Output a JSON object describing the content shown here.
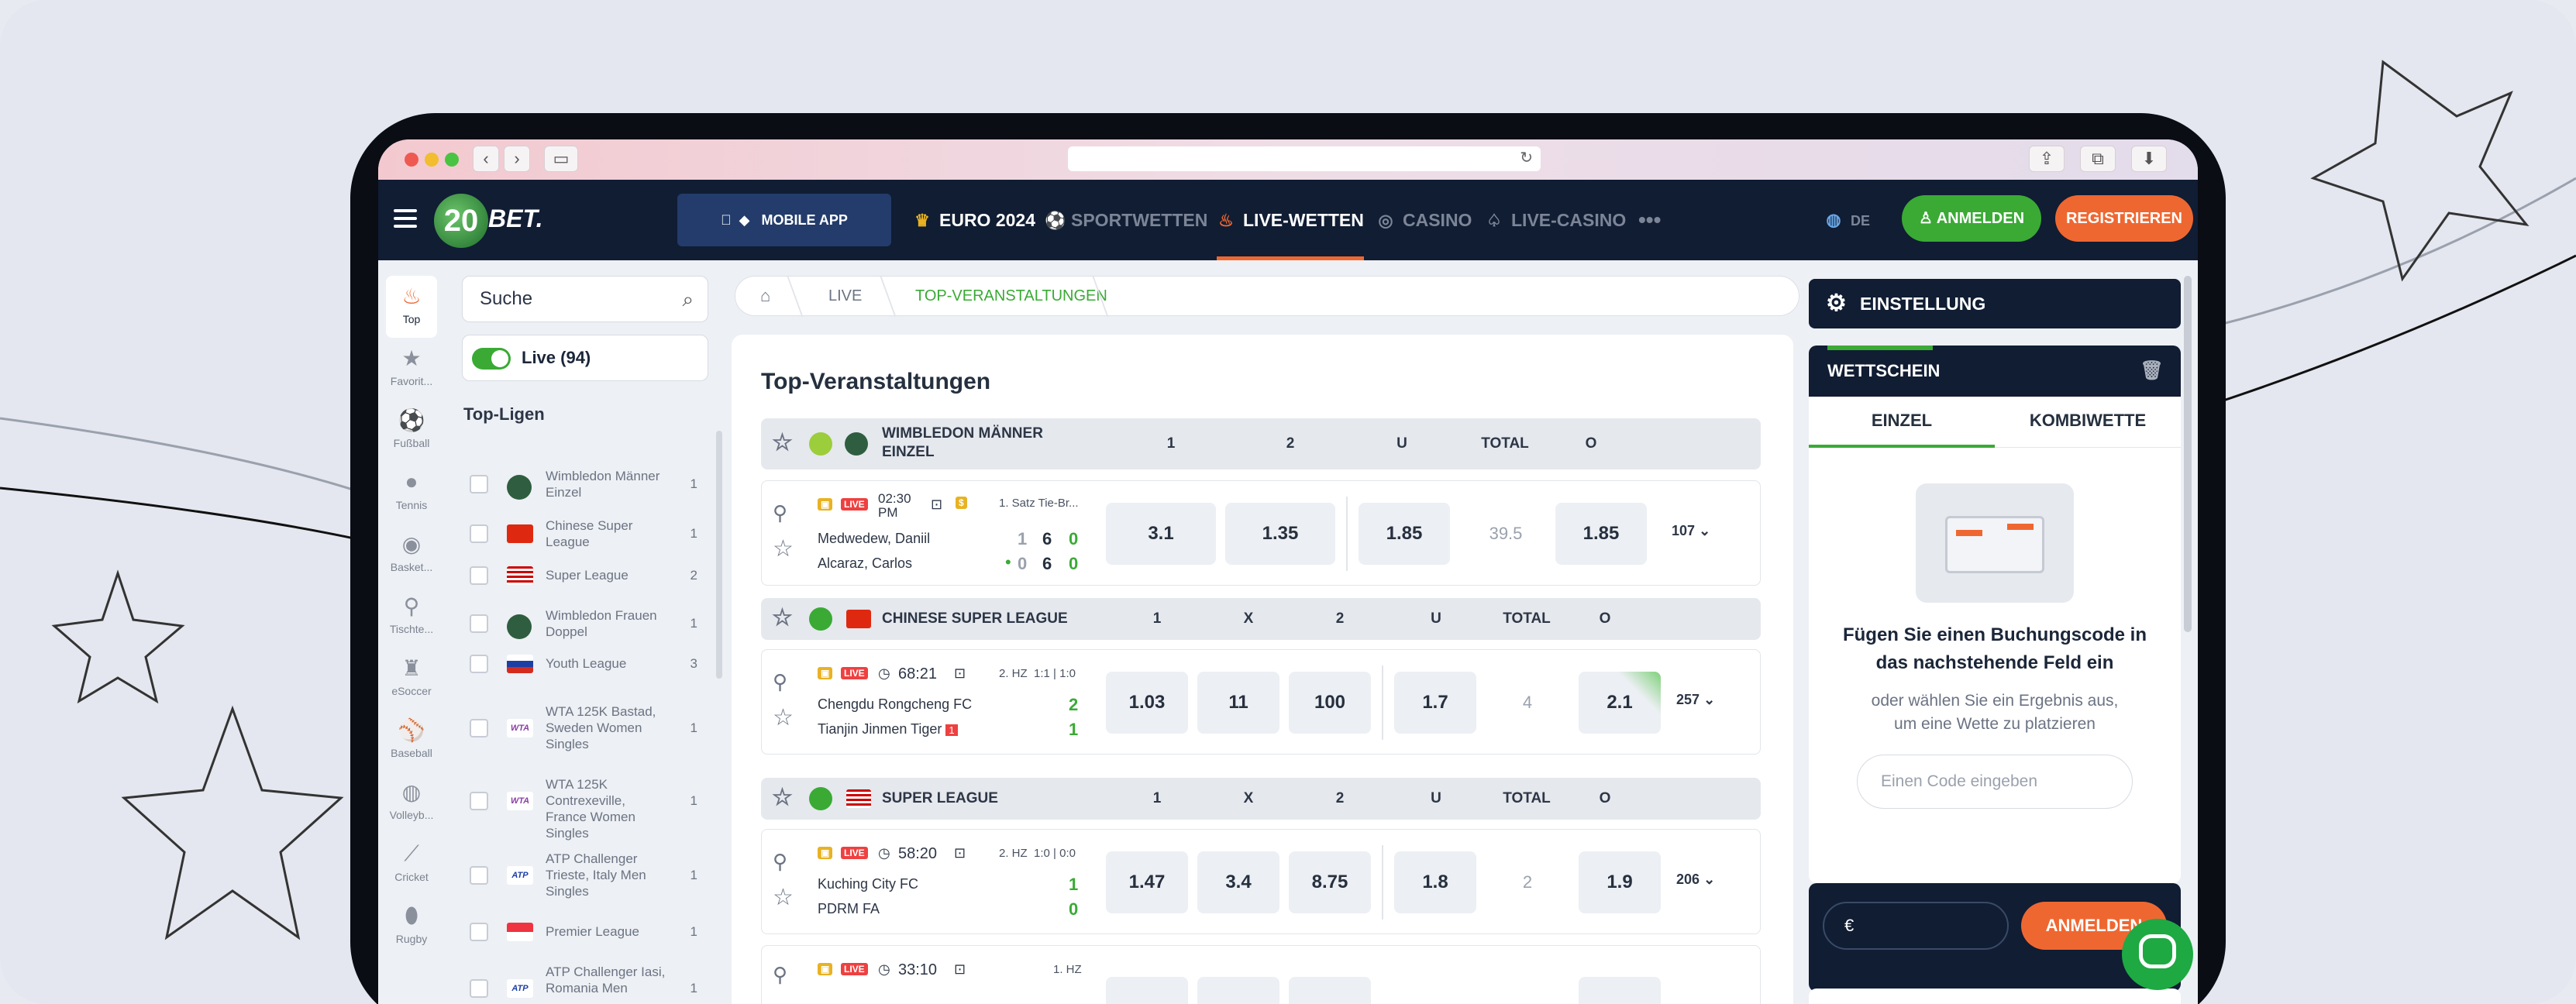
{
  "nav": {
    "mobile_app": "MOBILE APP",
    "euro": "EURO 2024",
    "sports": "SPORTWETTEN",
    "live": "LIVE-WETTEN",
    "casino": "CASINO",
    "live_casino": "LIVE-CASINO",
    "more": "•••",
    "lang": "DE",
    "login": "ANMELDEN",
    "register": "REGISTRIEREN",
    "logo_num": "20",
    "logo_text": "BET."
  },
  "colors": {
    "nav_bg": "#101d33",
    "accent_green": "#3aaa35",
    "accent_orange": "#ef6730"
  },
  "iconbar": [
    {
      "label": "Top",
      "icon": "fire-icon"
    },
    {
      "label": "Favorit...",
      "icon": "star-icon"
    },
    {
      "label": "Fußball",
      "icon": "football-icon"
    },
    {
      "label": "Tennis",
      "icon": "tennis-icon"
    },
    {
      "label": "Basket...",
      "icon": "basketball-icon"
    },
    {
      "label": "Tischte...",
      "icon": "table-tennis-icon"
    },
    {
      "label": "eSoccer",
      "icon": "esoccer-icon"
    },
    {
      "label": "Baseball",
      "icon": "baseball-icon"
    },
    {
      "label": "Volleyb...",
      "icon": "volleyball-icon"
    },
    {
      "label": "Cricket",
      "icon": "cricket-icon"
    },
    {
      "label": "Rugby",
      "icon": "rugby-icon"
    }
  ],
  "sidebar": {
    "search_placeholder": "Suche",
    "live_label": "Live (94)",
    "top_leagues": "Top-Ligen",
    "leagues": [
      {
        "name": "Wimbledon Männer Einzel",
        "count": "1"
      },
      {
        "name": "Chinese Super League",
        "count": "1"
      },
      {
        "name": "Super League",
        "count": "2"
      },
      {
        "name": "Wimbledon Frauen Doppel",
        "count": "1"
      },
      {
        "name": "Youth League",
        "count": "3"
      },
      {
        "name": "WTA 125K Bastad, Sweden Women Singles",
        "count": "1"
      },
      {
        "name": "WTA 125K Contrexeville, France Women Singles",
        "count": "1"
      },
      {
        "name": "ATP Challenger Trieste, Italy Men Singles",
        "count": "1"
      },
      {
        "name": "Premier League",
        "count": "1"
      },
      {
        "name": "ATP Challenger Iasi, Romania Men",
        "count": "1"
      }
    ]
  },
  "breadcrumb": {
    "live": "LIVE",
    "top": "TOP-VERANSTALTUNGEN"
  },
  "main": {
    "title": "Top-Veranstaltungen",
    "groups": [
      {
        "name": "WIMBLEDON MÄNNER EINZEL",
        "cols": [
          "1",
          "2",
          "U",
          "TOTAL",
          "O"
        ],
        "match": {
          "time": "02:30 PM",
          "period": "1. Satz Tie-Br...",
          "home": "Medwedew, Daniil",
          "away": "Alcaraz, Carlos",
          "home_scores": [
            "1",
            "6",
            "0"
          ],
          "away_scores": [
            "0",
            "6",
            "0"
          ],
          "odds": [
            "3.1",
            "1.35",
            "1.85",
            "39.5",
            "1.85"
          ],
          "more": "107"
        }
      },
      {
        "name": "CHINESE SUPER LEAGUE",
        "cols": [
          "1",
          "X",
          "2",
          "U",
          "TOTAL",
          "O"
        ],
        "match": {
          "time": "68:21",
          "period": "2. HZ",
          "p1": "1:1",
          "p2": "1:0",
          "home": "Chengdu Rongcheng FC",
          "away": "Tianjin Jinmen Tiger",
          "red_card": "1",
          "home_score": "2",
          "away_score": "1",
          "odds": [
            "1.03",
            "11",
            "100",
            "1.7",
            "4",
            "2.1"
          ],
          "more": "257"
        }
      },
      {
        "name": "SUPER LEAGUE",
        "cols": [
          "1",
          "X",
          "2",
          "U",
          "TOTAL",
          "O"
        ],
        "match": {
          "time": "58:20",
          "period": "2. HZ",
          "p1": "1:0",
          "p2": "0:0",
          "home": "Kuching City FC",
          "away": "PDRM FA",
          "home_score": "1",
          "away_score": "0",
          "odds": [
            "1.47",
            "3.4",
            "8.75",
            "1.8",
            "2",
            "1.9"
          ],
          "more": "206"
        }
      },
      {
        "match": {
          "time": "33:10",
          "period": "1. HZ"
        }
      }
    ]
  },
  "right": {
    "settings": "EINSTELLUNG",
    "slip_title": "WETTSCHEIN",
    "tab_single": "EINZEL",
    "tab_combo": "KOMBIWETTE",
    "booking_title": "Fügen Sie einen Buchungscode in das nachstehende Feld ein",
    "booking_sub": "oder wählen Sie ein Ergebnis aus, um eine Wette zu platzieren",
    "code_placeholder": "Einen Code eingeben",
    "currency": "€",
    "login": "ANMELDEN"
  }
}
